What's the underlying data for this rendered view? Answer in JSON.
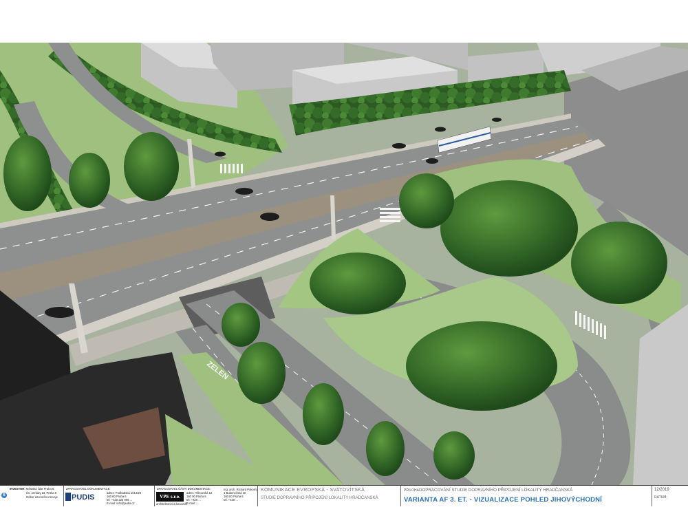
{
  "render": {
    "road_label": "ZELEN"
  },
  "titleblock": {
    "investor": {
      "label": "INVESTOR:",
      "lines": [
        "Městská část Praha 6,",
        "Čs. armády 23, Praha 6",
        "Odbor územního rozvoje"
      ],
      "seal_text": "6"
    },
    "zpracovatel_dokumentace": {
      "label": "ZPRACOVATEL DOKUMENTACE:",
      "logo_text": "PUDIS",
      "lines": [
        "adres: Podbabská 1014/20",
        "160 00 Praha 6",
        "tel: +420 225 996 ...",
        "E-mail: info@pudis.cz"
      ]
    },
    "zpracovatel_casti": {
      "label": "ZPRACOVATEL ČÁSTI DOKUMENTACE:",
      "logo_text": "VPE s.r.o.",
      "sub_text": "architektonická kancelář",
      "lines": [
        "adres: Tišnovská 12",
        "160 00 Praha 6",
        "tel: +420 ...",
        "E-mail: ..."
      ],
      "right_lines": [
        "Ing. arch. Richard Pokorný",
        "1 Bubenečská 10",
        "160 00 Praha 6",
        "tel: +420 ..."
      ]
    },
    "project_title": "KOMUNIKACE EVROPSKÁ - SVATOVÍTSKÁ",
    "project_subtitle": "STUDIE DOPRAVNÍHO PŘIPOJENÍ LOKALITY HRADČANSKÁ",
    "attachment_label": "PŘÍLOHA:",
    "attachment_text": "DOPRACOVÁNÍ STUDIE DOPRAVNÍHO PŘIPOJENÍ LOKALITY HRADČANSKÁ",
    "variant_title": "VARIANTA AF 3. ET. - VIZUALIZACE POHLED JIHOVÝCHODNÍ",
    "date_label": "DATUM:",
    "date_value": "12/2019"
  },
  "colors": {
    "variant_blue": "#2a6fb5",
    "pudis_blue": "#1a3f7a",
    "grass": "#9cc17e",
    "asphalt": "#8e908f",
    "tram_track": "#9c907f",
    "building_gray": "#c8c8c8"
  }
}
